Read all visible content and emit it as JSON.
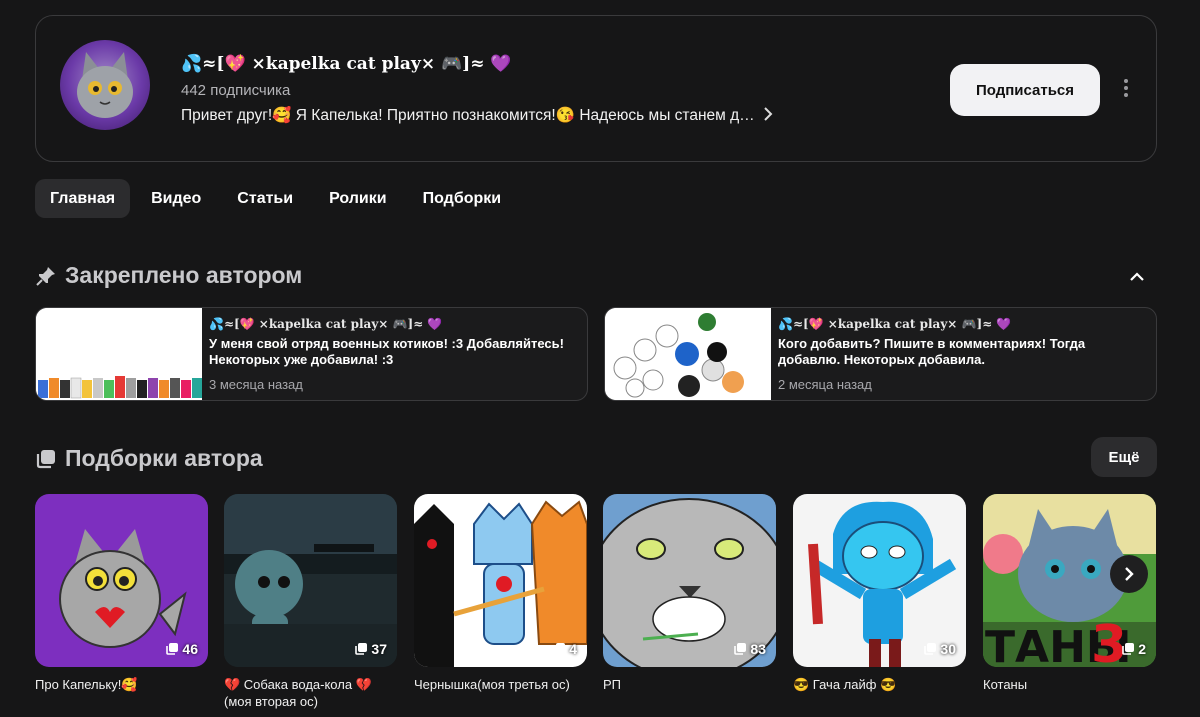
{
  "channel": {
    "name": "💦≈[💖 ×kapelka cat play× 🎮]≈ 💜",
    "subscribers": "442 подписчика",
    "description": "Привет друг!🥰 Я Капелька! Приятно познакомится!😘 Надеюсь мы станем друзьями",
    "subscribe_label": "Подписаться"
  },
  "tabs": [
    {
      "label": "Главная",
      "active": true
    },
    {
      "label": "Видео",
      "active": false
    },
    {
      "label": "Статьи",
      "active": false
    },
    {
      "label": "Ролики",
      "active": false
    },
    {
      "label": "Подборки",
      "active": false
    }
  ],
  "pinned": {
    "title": "Закреплено автором",
    "items": [
      {
        "author": "💦≈[💖 ×kapelka cat play× 🎮]≈ 💜",
        "text": "У меня свой отряд военных котиков! :3 Добавляйтесь! Некоторых уже добавила! :3",
        "date": "3 месяца назад"
      },
      {
        "author": "💦≈[💖 ×kapelka cat play× 🎮]≈ 💜",
        "text": "Кого добавить? Пишите в комментариях! Тогда добавлю. Некоторых добавила.",
        "date": "2 месяца назад"
      }
    ]
  },
  "collections": {
    "title": "Подборки автора",
    "more_label": "Ещё",
    "items": [
      {
        "title": "Про Капельку!🥰",
        "count": "46"
      },
      {
        "title": "💔 Собака вода-кола 💔 (моя вторая ос)",
        "count": "37"
      },
      {
        "title": "Чернышка(моя третья ос)",
        "count": "4"
      },
      {
        "title": "РП",
        "count": "83"
      },
      {
        "title": "😎 Гача лайф 😎",
        "count": "30"
      },
      {
        "title": "Котаны",
        "count": "2"
      }
    ]
  },
  "colors": {
    "background": "#161617",
    "card_border": "#3a3a3c",
    "active_tab": "#2c2c2e",
    "subscribe_bg": "#f2f2f4"
  }
}
